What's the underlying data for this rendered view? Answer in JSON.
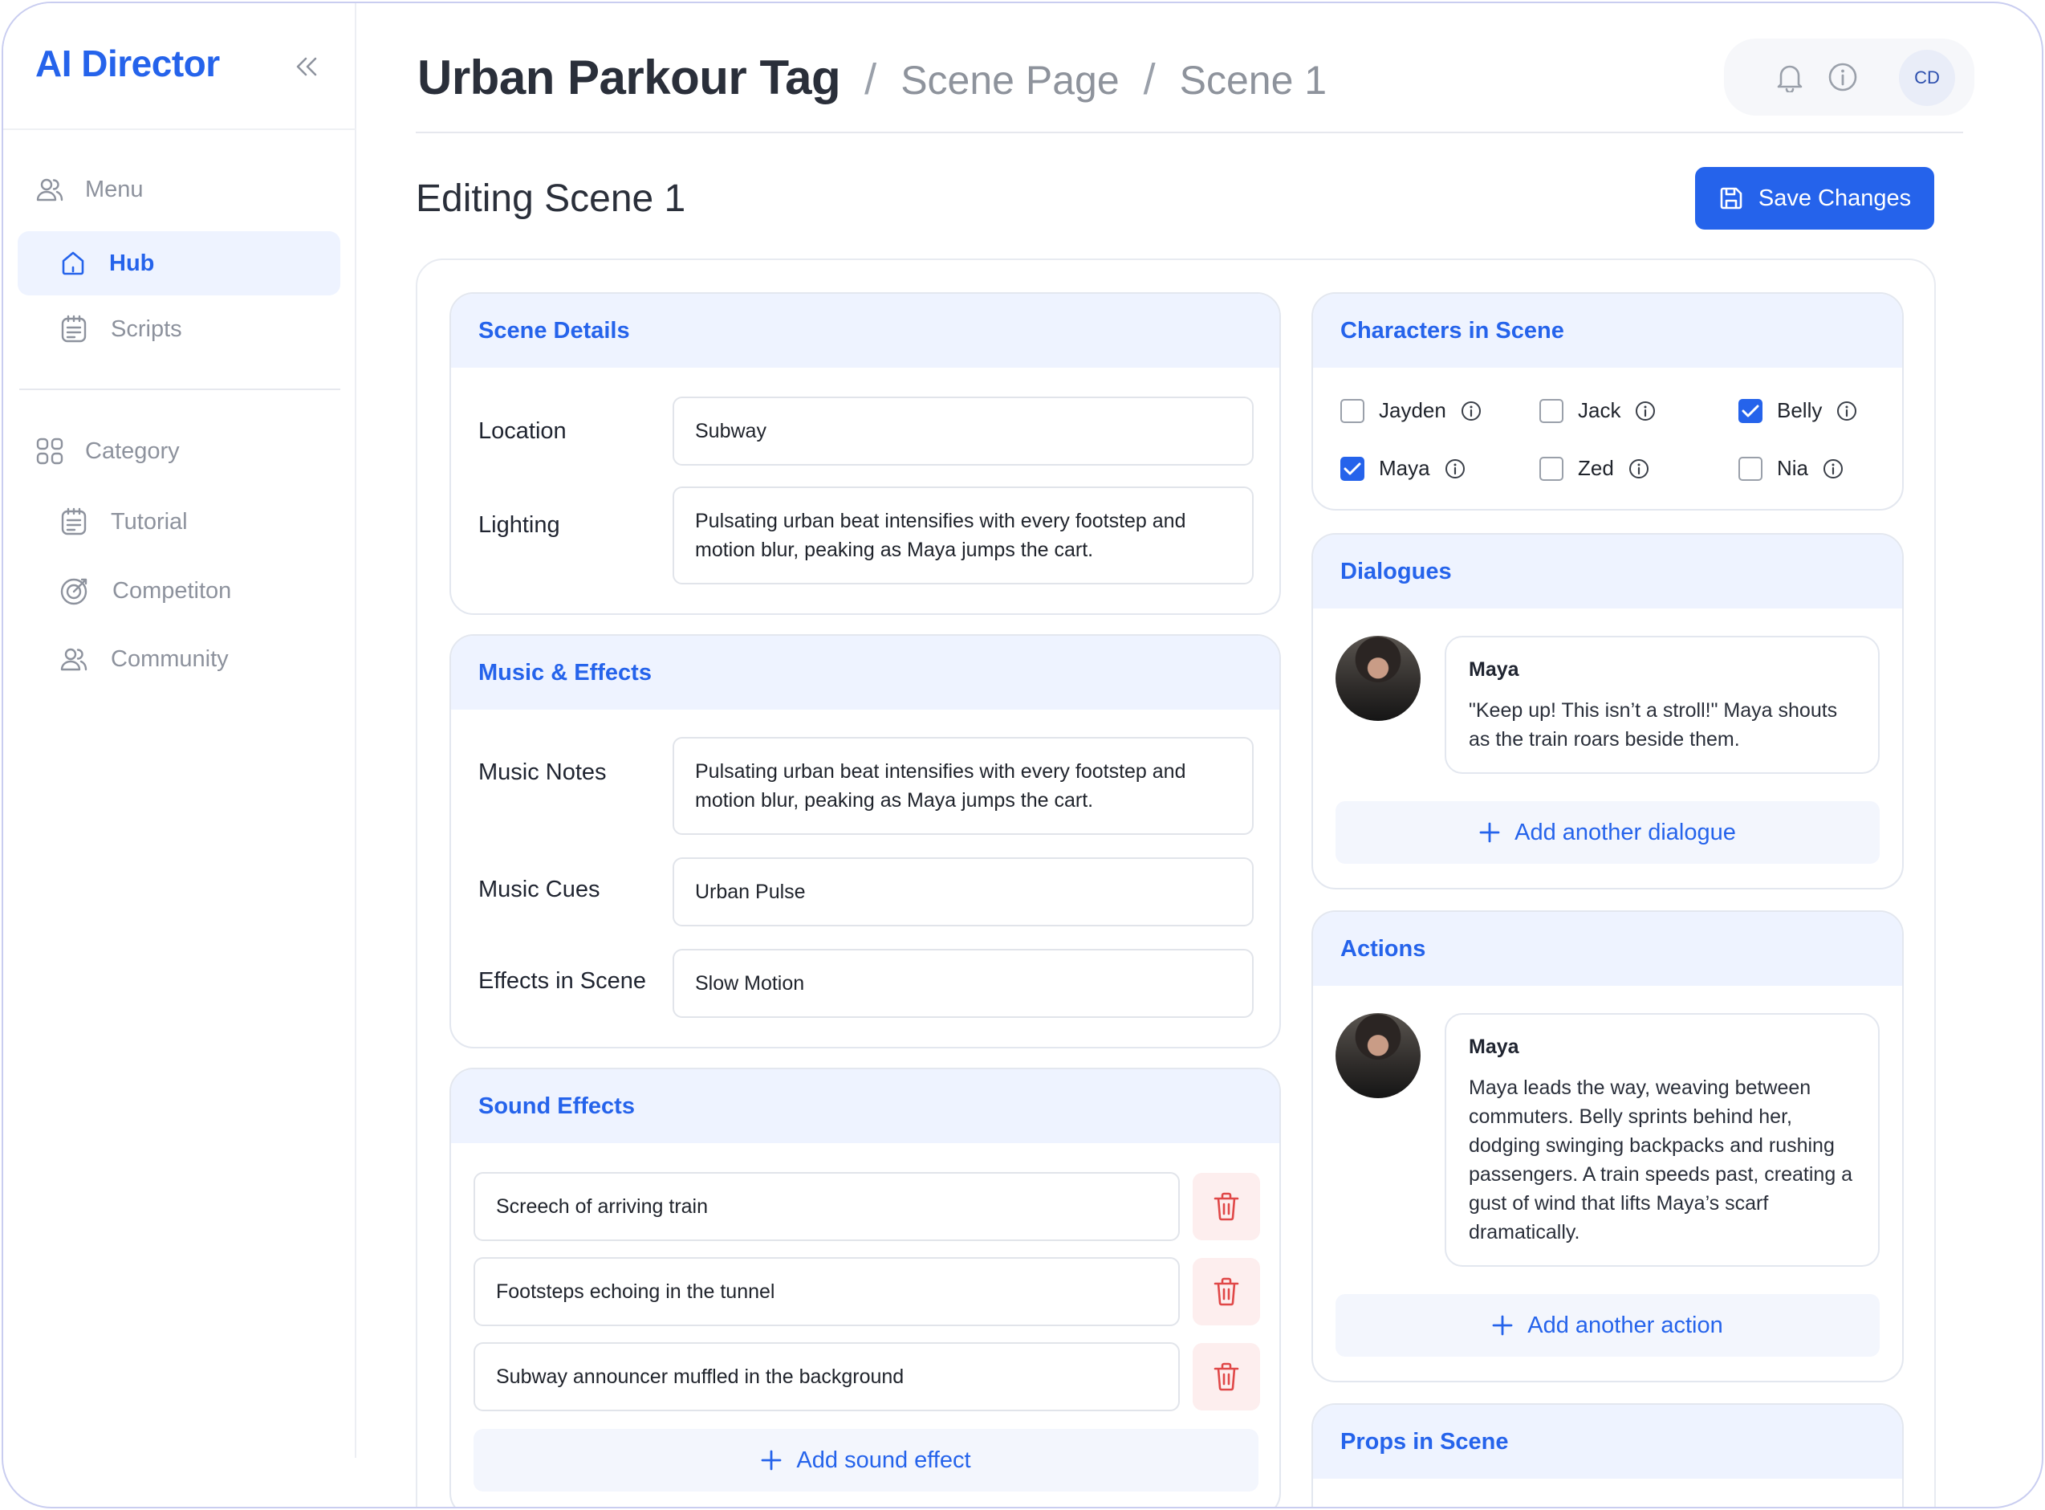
{
  "app": {
    "brand": "AI Director"
  },
  "sidebar": {
    "menu_label": "Menu",
    "hub": "Hub",
    "scripts": "Scripts",
    "category_label": "Category",
    "tutorial": "Tutorial",
    "competition": "Competiton",
    "community": "Community"
  },
  "header": {
    "project_title": "Urban Parkour Tag",
    "crumb_1": "Scene Page",
    "crumb_2": "Scene 1",
    "separator": "/",
    "avatar_initials": "CD"
  },
  "page": {
    "title": "Editing Scene 1",
    "save_label": "Save Changes"
  },
  "scene_details": {
    "heading": "Scene Details",
    "location_label": "Location",
    "location_value": "Subway",
    "lighting_label": "Lighting",
    "lighting_value": "Pulsating urban beat intensifies with every footstep and motion blur, peaking as Maya jumps the cart."
  },
  "music_effects": {
    "heading": "Music & Effects",
    "notes_label": "Music Notes",
    "notes_value": "Pulsating urban beat intensifies with every footstep and motion blur, peaking as Maya jumps the cart.",
    "cues_label": "Music Cues",
    "cues_value": "Urban Pulse",
    "effects_label": "Effects in Scene",
    "effects_value": "Slow Motion"
  },
  "sound_effects": {
    "heading": "Sound Effects",
    "items": [
      "Screech of arriving train",
      "Footsteps echoing in the tunnel",
      "Subway announcer muffled in the background"
    ],
    "add_label": "Add sound effect"
  },
  "characters": {
    "heading": "Characters in Scene",
    "items": [
      {
        "name": "Jayden",
        "checked": false
      },
      {
        "name": "Jack",
        "checked": false
      },
      {
        "name": "Belly",
        "checked": true
      },
      {
        "name": "Maya",
        "checked": true
      },
      {
        "name": "Zed",
        "checked": false
      },
      {
        "name": "Nia",
        "checked": false
      }
    ]
  },
  "dialogues": {
    "heading": "Dialogues",
    "items": [
      {
        "speaker": "Maya",
        "text": "\"Keep up! This isn’t a stroll!\" Maya shouts as the train roars beside them."
      }
    ],
    "add_label": "Add another dialogue"
  },
  "actions": {
    "heading": "Actions",
    "items": [
      {
        "actor": "Maya",
        "text": "Maya leads the way, weaving between commuters. Belly sprints behind her, dodging swinging backpacks and rushing passengers. A train speeds past, creating a gust of wind that lifts Maya’s scarf dramatically."
      }
    ],
    "add_label": "Add another action"
  },
  "props": {
    "heading": "Props in Scene"
  },
  "colors": {
    "accent": "#2563eb",
    "card_header_bg": "#eef3ff",
    "danger_bg": "#fdeeee",
    "danger": "#e04848"
  }
}
